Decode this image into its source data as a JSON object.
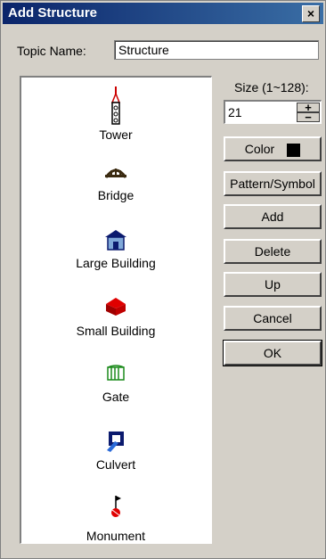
{
  "window": {
    "title": "Add Structure",
    "close_label": "×"
  },
  "topic": {
    "label": "Topic Name:",
    "value": "Structure"
  },
  "size": {
    "label": "Size (1~128):",
    "value": "21"
  },
  "color": {
    "swatch": "#000000"
  },
  "buttons": {
    "color": "Color",
    "pattern": "Pattern/Symbol",
    "add": "Add",
    "delete": "Delete",
    "up": "Up",
    "cancel": "Cancel",
    "ok": "OK"
  },
  "structures": [
    {
      "label": "Tower",
      "icon": "tower-icon"
    },
    {
      "label": "Bridge",
      "icon": "bridge-icon"
    },
    {
      "label": "Large Building",
      "icon": "large-building-icon"
    },
    {
      "label": "Small Building",
      "icon": "small-building-icon"
    },
    {
      "label": "Gate",
      "icon": "gate-icon"
    },
    {
      "label": "Culvert",
      "icon": "culvert-icon"
    },
    {
      "label": "Monument",
      "icon": "monument-icon"
    }
  ]
}
